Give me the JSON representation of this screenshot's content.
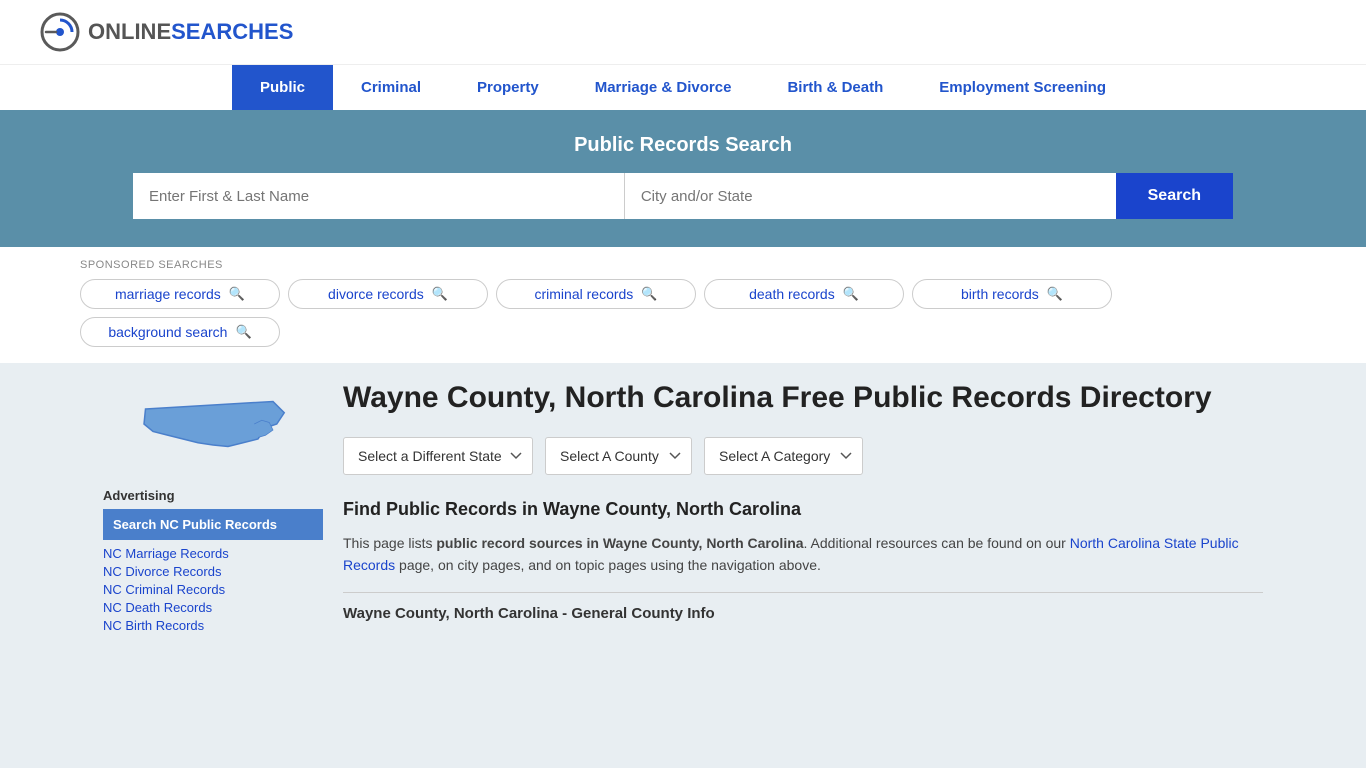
{
  "header": {
    "logo_online": "ONLINE",
    "logo_searches": "SEARCHES"
  },
  "nav": {
    "items": [
      {
        "label": "Public",
        "active": true
      },
      {
        "label": "Criminal",
        "active": false
      },
      {
        "label": "Property",
        "active": false
      },
      {
        "label": "Marriage & Divorce",
        "active": false
      },
      {
        "label": "Birth & Death",
        "active": false
      },
      {
        "label": "Employment Screening",
        "active": false
      }
    ]
  },
  "search_banner": {
    "title": "Public Records Search",
    "name_placeholder": "Enter First & Last Name",
    "location_placeholder": "City and/or State",
    "button_label": "Search"
  },
  "sponsored": {
    "label": "SPONSORED SEARCHES",
    "pills": [
      {
        "text": "marriage records"
      },
      {
        "text": "divorce records"
      },
      {
        "text": "criminal records"
      },
      {
        "text": "death records"
      },
      {
        "text": "birth records"
      },
      {
        "text": "background search"
      }
    ]
  },
  "page_title": "Wayne County, North Carolina Free Public Records Directory",
  "dropdowns": {
    "state": "Select a Different State",
    "county": "Select A County",
    "category": "Select A Category"
  },
  "find_section": {
    "title": "Find Public Records in Wayne County, North Carolina",
    "description_start": "This page lists ",
    "description_bold": "public record sources in Wayne County, North Carolina",
    "description_mid": ". Additional resources can be found on our ",
    "description_link": "North Carolina State Public Records",
    "description_end": " page, on city pages, and on topic pages using the navigation above."
  },
  "general_info_title": "Wayne County, North Carolina - General County Info",
  "sidebar": {
    "advertising_label": "Advertising",
    "ad_highlighted": "Search NC Public Records",
    "ad_links": [
      "NC Marriage Records",
      "NC Divorce Records",
      "NC Criminal Records",
      "NC Death Records",
      "NC Birth Records"
    ]
  }
}
